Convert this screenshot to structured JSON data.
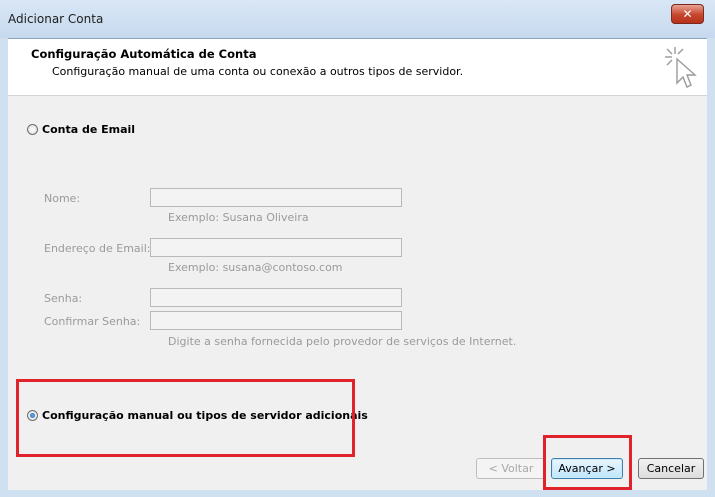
{
  "window": {
    "title": "Adicionar Conta",
    "close_label": "✕"
  },
  "header": {
    "title": "Configuração Automática de Conta",
    "subtitle": "Configuração manual de uma conta ou conexão a outros tipos de servidor."
  },
  "options": {
    "email_account": {
      "label": "Conta de Email",
      "checked": false
    },
    "manual_config": {
      "label": "Configuração manual ou tipos de servidor adicionais",
      "checked": true
    }
  },
  "form": {
    "name": {
      "label": "Nome:",
      "value": "",
      "hint": "Exemplo: Susana Oliveira"
    },
    "email": {
      "label": "Endereço de Email:",
      "value": "",
      "hint": "Exemplo: susana@contoso.com"
    },
    "password": {
      "label": "Senha:",
      "value": ""
    },
    "confirm_password": {
      "label": "Confirmar Senha:",
      "value": ""
    },
    "password_hint": "Digite a senha fornecida pelo provedor de serviços de Internet."
  },
  "buttons": {
    "back": "< Voltar",
    "next": "Avançar >",
    "cancel": "Cancelar"
  },
  "colors": {
    "highlight": "#e0222a",
    "titlebar": "#d9e7f6",
    "dialog_bg": "#f0f0f0"
  }
}
